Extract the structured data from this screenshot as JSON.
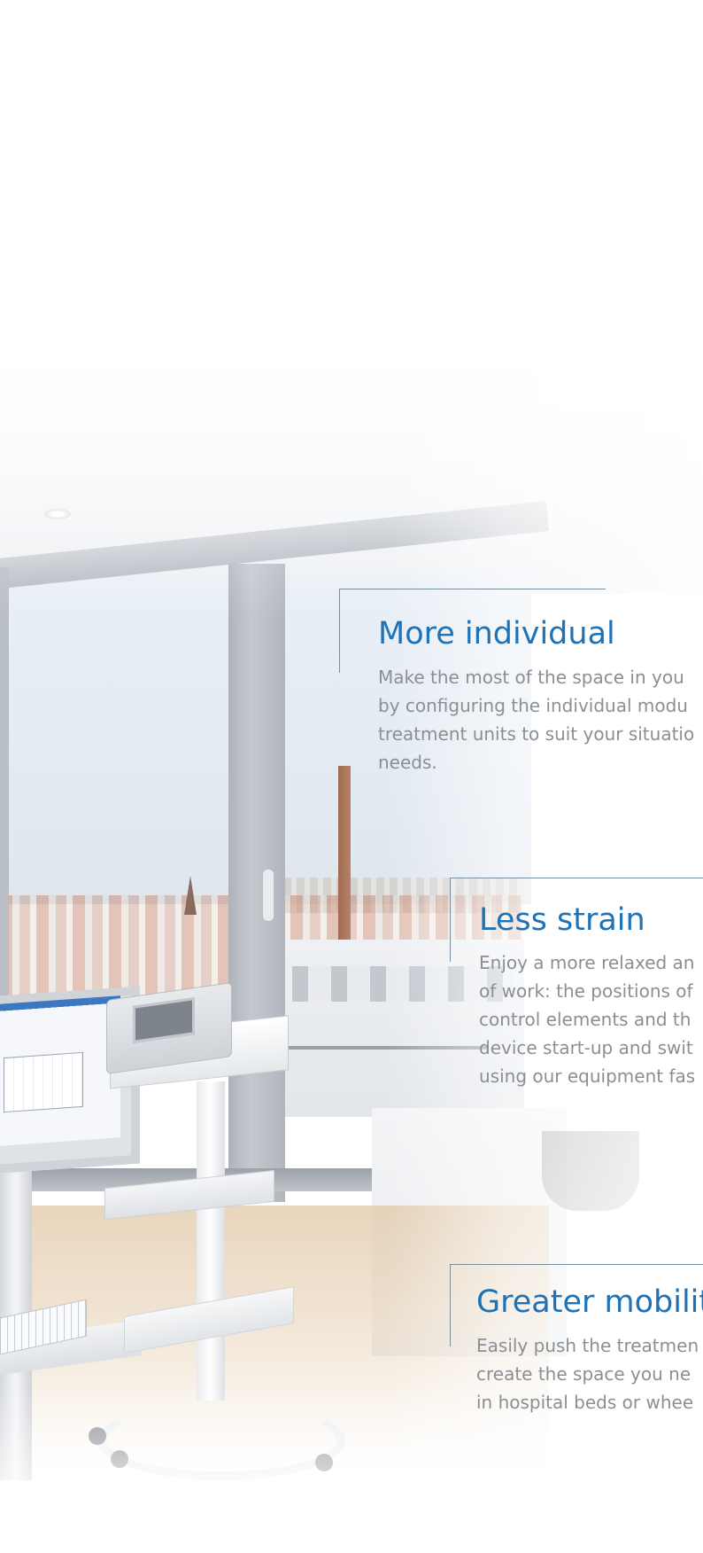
{
  "features": [
    {
      "title": "More individual",
      "body": "Make the most of the space in you\nby configuring the individual modu\ntreatment units to suit your situatio\nneeds."
    },
    {
      "title": "Less strain",
      "body": "Enjoy a more relaxed an\nof work: the positions of\ncontrol elements and th\ndevice start-up and swit\nusing our equipment fas"
    },
    {
      "title": "Greater mobility",
      "body": "Easily push the treatmen\ncreate the space you ne\nin hospital beds or whee"
    }
  ],
  "colors": {
    "heading": "#1d72b8",
    "body_text": "#8b8f94",
    "bracket_line": "#7a8d9c"
  }
}
